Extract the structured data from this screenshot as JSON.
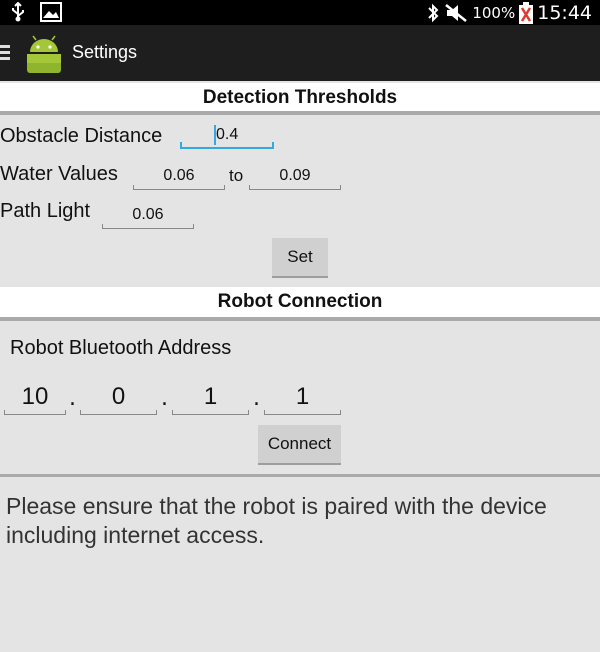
{
  "status_bar": {
    "battery": "100%",
    "time": "15:44"
  },
  "action_bar": {
    "title": "Settings"
  },
  "detection": {
    "header": "Detection Thresholds",
    "obstacle_label": "Obstacle Distance",
    "obstacle_value": "0.4",
    "water_label": "Water Values",
    "water_min": "0.06",
    "water_to": "to",
    "water_max": "0.09",
    "path_label": "Path Light",
    "path_value": "0.06",
    "set_label": "Set"
  },
  "robot": {
    "header": "Robot Connection",
    "address_label": "Robot Bluetooth Address",
    "octets": [
      "10",
      "0",
      "1",
      "1"
    ],
    "dot": ".",
    "connect_label": "Connect"
  },
  "notice": "Please ensure that the robot is paired with the device including internet access."
}
